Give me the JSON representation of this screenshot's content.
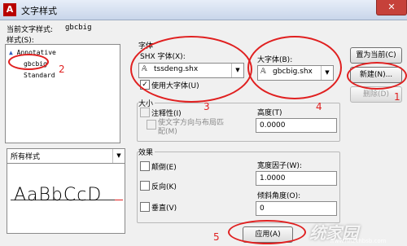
{
  "window": {
    "app_icon": "A",
    "title": "文字样式",
    "close": "✕"
  },
  "current_style": {
    "label": "当前文字样式:",
    "value": "gbcbig"
  },
  "styles": {
    "label": "样式(S):",
    "items": [
      "Annotative",
      "gbcbig",
      "Standard"
    ],
    "selected": "gbcbig"
  },
  "filter": {
    "value": "所有样式"
  },
  "font": {
    "group_label": "字体",
    "shx_label": "SHX 字体(X):",
    "shx_value": "tssdeng.shx",
    "bigfont_label": "大字体(B):",
    "bigfont_value": "gbcbig.shx",
    "use_bigfont_label": "使用大字体(U)",
    "use_bigfont_checked": true
  },
  "size": {
    "group_label": "大小",
    "annotative_label": "注释性(I)",
    "match_orientation_label": "使文字方向与布局匹配(M)",
    "height_label": "高度(T)",
    "height_value": "0.0000"
  },
  "effects": {
    "group_label": "效果",
    "upside_down": "颠倒(E)",
    "backwards": "反向(K)",
    "vertical": "垂直(V)",
    "width_factor_label": "宽度因子(W):",
    "width_factor_value": "1.0000",
    "oblique_label": "倾斜角度(O):",
    "oblique_value": "0"
  },
  "buttons": {
    "set_current": "置为当前(C)",
    "new": "新建(N)...",
    "delete": "删除(D)",
    "apply": "应用(A)"
  },
  "preview": {
    "text": "AaBbCcD"
  },
  "annotations": [
    "1",
    "2",
    "3",
    "4",
    "5"
  ],
  "watermark": {
    "text": "统家园",
    "sub": "www.hnzkhbsb.com"
  },
  "colors": {
    "annotation_red": "#e02020",
    "title_bar": "#c8d6ea",
    "close_button": "#c6413a"
  }
}
